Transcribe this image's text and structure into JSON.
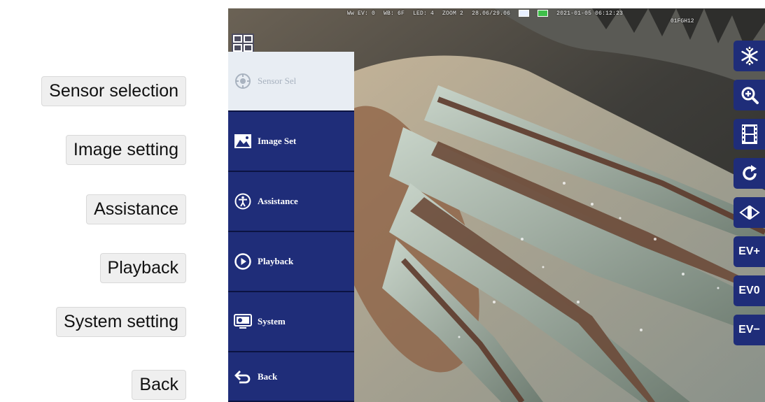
{
  "callouts": {
    "sensor_selection": "Sensor selection",
    "image_setting": "Image setting",
    "assistance": "Assistance",
    "playback": "Playback",
    "system_setting": "System setting",
    "back": "Back"
  },
  "status_bar": {
    "ev": "Ww EV: 0",
    "wb": "WB: 6F",
    "led": "LED: 4",
    "zoom": "ZOOM 2",
    "coords": "28.06/29.06",
    "datetime": "2021-01-05 06:12:23",
    "serial": "01FGH12"
  },
  "menu": {
    "items": [
      {
        "label": "Sensor Sel",
        "icon": "sensor-icon",
        "active": true
      },
      {
        "label": "Image Set",
        "icon": "image-icon",
        "active": false
      },
      {
        "label": "Assistance",
        "icon": "accessibility-icon",
        "active": false
      },
      {
        "label": "Playback",
        "icon": "play-icon",
        "active": false
      },
      {
        "label": "System",
        "icon": "system-icon",
        "active": false
      },
      {
        "label": "Back",
        "icon": "back-arrow-icon",
        "active": false
      }
    ]
  },
  "toolbar": {
    "freeze_icon": "snowflake-icon",
    "zoom_icon": "zoom-in-icon",
    "film_icon": "film-icon",
    "rotate_icon": "rotate-icon",
    "mirror_icon": "mirror-icon",
    "ev_plus": "EV+",
    "ev_zero": "EV0",
    "ev_minus": "EV−"
  },
  "colors": {
    "menu_blue": "#1f2d79",
    "menu_active": "#e8edf3",
    "callout_bg": "#efefef"
  }
}
